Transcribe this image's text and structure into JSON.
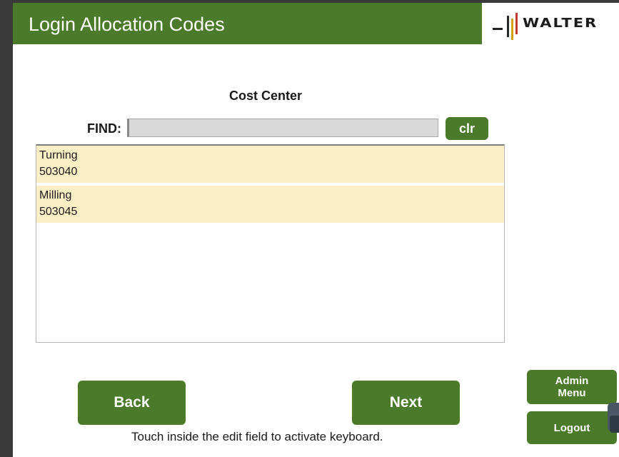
{
  "header": {
    "title": "Login Allocation Codes",
    "logo_text": "WALTER",
    "colors": {
      "brand_green": "#4b7a2b",
      "logo_bars": [
        "#2a2a2a",
        "#d4a017",
        "#c0392b"
      ]
    }
  },
  "section": {
    "title": "Cost Center"
  },
  "find": {
    "label": "FIND:",
    "value": "",
    "placeholder": "",
    "clear_label": "clr"
  },
  "list": {
    "highlight_color": "#fcefc6",
    "items": [
      {
        "name": "Turning",
        "code": "503040"
      },
      {
        "name": "Milling",
        "code": "503045"
      }
    ]
  },
  "buttons": {
    "back_label": "Back",
    "next_label": "Next",
    "admin_label_line1": "Admin",
    "admin_label_line2": "Menu",
    "logout_label": "Logout"
  },
  "hint": "Touch inside the edit field to activate keyboard."
}
